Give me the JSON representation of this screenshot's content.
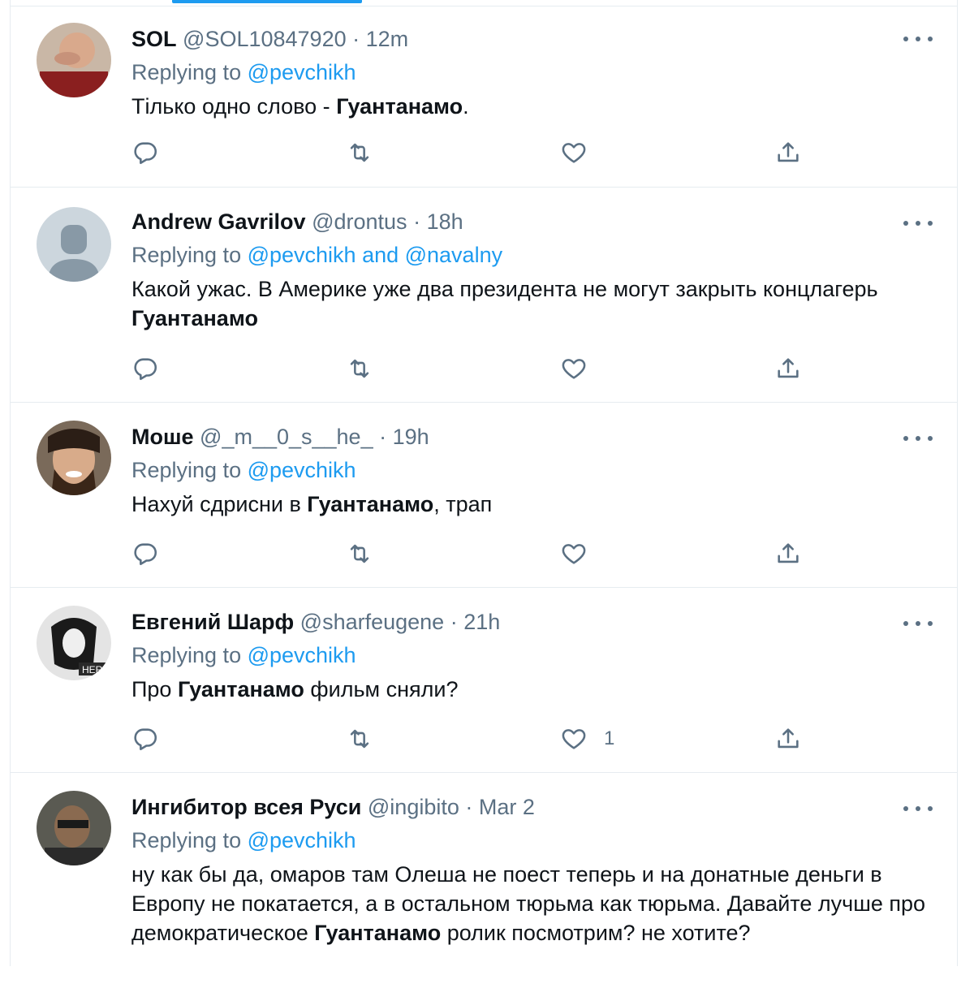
{
  "tweets": [
    {
      "name": "SOL",
      "handle": "@SOL10847920",
      "time": "12m",
      "replying_prefix": "Replying to ",
      "replying_to": "@pevchikh",
      "text_parts": [
        "Тілько одно слово - ",
        "Гуантанамо",
        "."
      ],
      "like_count": "",
      "avatar_color": "#8a3a2e"
    },
    {
      "name": "Andrew Gavrilov",
      "handle": "@drontus",
      "time": "18h",
      "replying_prefix": "Replying to ",
      "replying_to": "@pevchikh and @navalny",
      "text_parts": [
        "Какой ужас. В Америке уже два президента не могут закрыть концлагерь ",
        "Гуантанамо",
        ""
      ],
      "like_count": "",
      "avatar_color": "#ccd6dd"
    },
    {
      "name": "Моше",
      "handle": "@_m__0_s__he_",
      "time": "19h",
      "replying_prefix": "Replying to ",
      "replying_to": "@pevchikh",
      "text_parts": [
        "Нахуй сдрисни в ",
        "Гуантанамо",
        ", трап"
      ],
      "like_count": "",
      "avatar_color": "#6b4a36"
    },
    {
      "name": "Евгений Шарф",
      "handle": "@sharfeugene",
      "time": "21h",
      "replying_prefix": "Replying to ",
      "replying_to": "@pevchikh",
      "text_parts": [
        "Про ",
        "Гуантанамо",
        " фильм сняли?"
      ],
      "like_count": "1",
      "avatar_color": "#d9d9d9"
    },
    {
      "name": "Ингибитор всея Руси",
      "handle": "@ingibito",
      "time": "Mar 2",
      "replying_prefix": "Replying to ",
      "replying_to": "@pevchikh",
      "text_parts": [
        "ну как бы да, омаров там Олеша не поест теперь и на донатные деньги в Европу не покатается, а в остальном тюрьма как тюрьма. Давайте лучше про демократическое ",
        "Гуантанамо",
        " ролик посмотрим? не хотите?"
      ],
      "like_count": "",
      "avatar_color": "#3b3b3b"
    }
  ],
  "separator": " · ",
  "icons": [
    "reply-icon",
    "retweet-icon",
    "like-icon",
    "share-icon",
    "more-icon"
  ],
  "colors": {
    "link": "#1d9bf0",
    "muted": "#5b7083",
    "text": "#0f1419"
  }
}
